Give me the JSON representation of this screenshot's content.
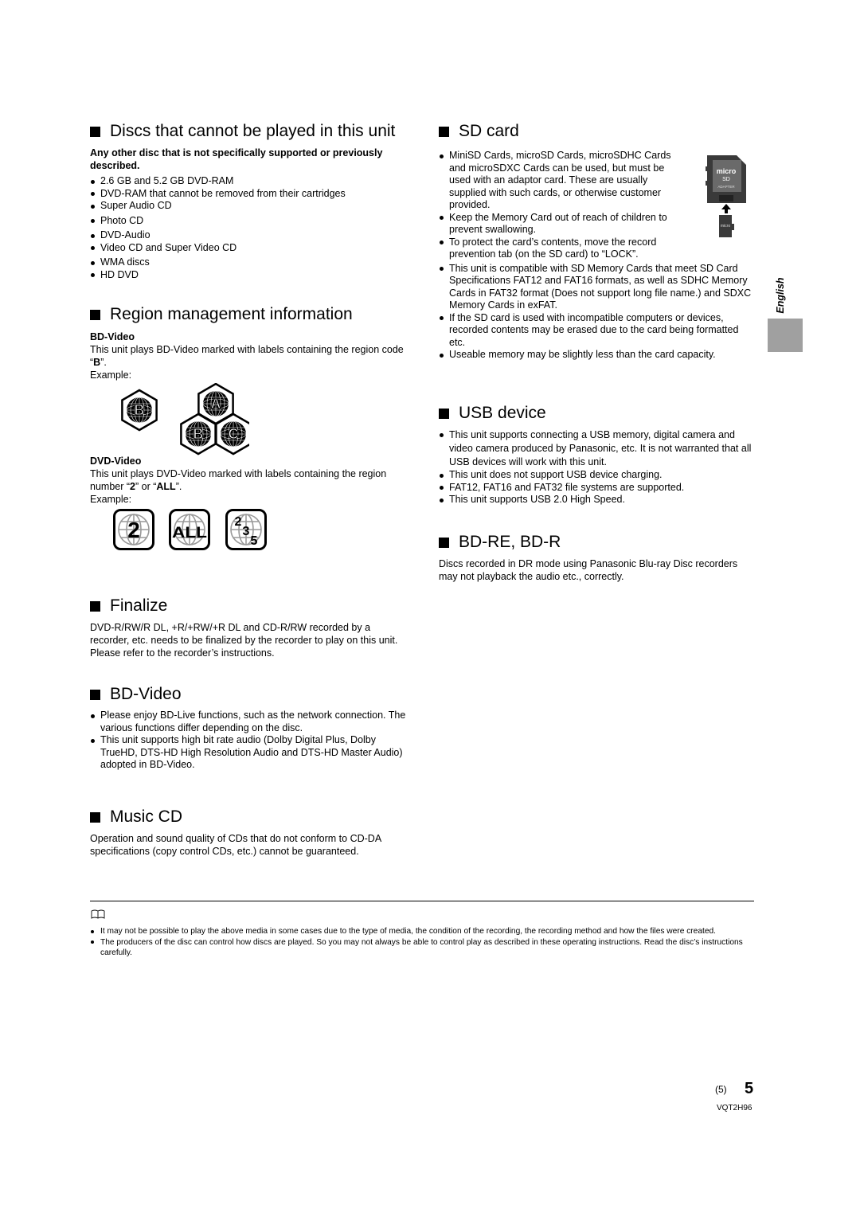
{
  "sections": {
    "discs_not_playable": {
      "title": "Discs that cannot be played in this unit",
      "intro": "Any other disc that is not specifically supported or previously described.",
      "items": [
        "2.6 GB and 5.2 GB DVD-RAM",
        "DVD-RAM that cannot be removed from their cartridges",
        "Super Audio CD",
        "Photo CD",
        "DVD-Audio",
        "Video CD and Super Video CD",
        "WMA discs",
        "HD DVD"
      ]
    },
    "region": {
      "title": "Region management information",
      "bd": {
        "heading": "BD-Video",
        "text_before": "This unit plays BD-Video marked with labels containing the region code “",
        "code": "B",
        "text_after": "”.",
        "example": "Example:",
        "logos": [
          "B",
          "A",
          "B",
          "C"
        ]
      },
      "dvd": {
        "heading": "DVD-Video",
        "text_before": "This unit plays DVD-Video marked with labels containing the region number “",
        "code1": "2",
        "text_mid": "” or “",
        "code2": "ALL",
        "text_after": "”.",
        "example": "Example:",
        "logos": [
          {
            "label": "2"
          },
          {
            "label": "ALL"
          },
          {
            "d1": "2",
            "d2": "3",
            "d3": "5"
          }
        ]
      }
    },
    "finalize": {
      "title": "Finalize",
      "text": "DVD-R/RW/R DL, +R/+RW/+R DL and CD-R/RW recorded by a recorder, etc. needs to be finalized by the recorder to play on this unit. Please refer to the recorder’s instructions."
    },
    "bd_video": {
      "title": "BD-Video",
      "items": [
        "Please enjoy BD-Live functions, such as the network connection. The various functions differ depending on the disc.",
        "This unit supports high bit rate audio (Dolby Digital Plus, Dolby TrueHD, DTS-HD High Resolution Audio and DTS-HD Master Audio) adopted in BD-Video."
      ]
    },
    "music_cd": {
      "title": "Music CD",
      "text": "Operation and sound quality of CDs that do not conform to CD-DA specifications (copy control CDs, etc.) cannot be guaranteed."
    },
    "sd_card": {
      "title": "SD card",
      "items": [
        "MiniSD Cards, microSD Cards, microSDHC Cards and microSDXC Cards can be used, but must be used with an adaptor card. These are usually supplied with such cards, or otherwise customer provided.",
        "Keep the Memory Card out of reach of children to prevent swallowing.",
        "To protect the card’s contents, move the record prevention tab (on the SD card) to “LOCK”.",
        "This unit is compatible with SD Memory Cards that meet SD Card Specifications FAT12 and FAT16 formats, as well as SDHC Memory Cards in FAT32 format (Does not support long file name.) and SDXC Memory Cards in exFAT.",
        "If the SD card is used with incompatible computers or devices, recorded contents may be erased due to the card being formatted etc.",
        "Useable memory may be slightly less than the card capacity."
      ],
      "image": {
        "adapter_label": "ADAPTER",
        "brand": "micro SD"
      }
    },
    "usb": {
      "title": "USB device",
      "items": [
        "This unit supports connecting a USB memory, digital camera and video camera produced by Panasonic, etc. It is not warranted that all USB devices will work with this unit.",
        "This unit does not support USB device charging.",
        "FAT12, FAT16 and FAT32 file systems are supported.",
        "This unit supports USB 2.0 High Speed."
      ]
    },
    "bdre": {
      "title": "BD-RE, BD-R",
      "text": "Discs recorded in DR mode using Panasonic Blu-ray Disc recorders may not playback the audio etc., correctly."
    }
  },
  "side_tab": {
    "language": "English"
  },
  "notes": [
    "It may not be possible to play the above media in some cases due to the type of media, the condition of the recording, the recording method and how the files were created.",
    "The producers of the disc can control how discs are played. So you may not always be able to control play as described in these operating instructions. Read the disc’s instructions carefully."
  ],
  "footer": {
    "page_paren": "(5)",
    "page": "5",
    "doc_code": "VQT2H96"
  }
}
